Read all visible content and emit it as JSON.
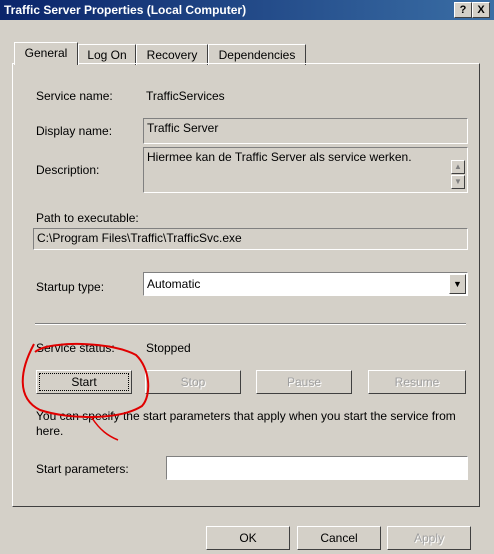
{
  "window": {
    "title": "Traffic Server Properties (Local Computer)",
    "help_btn": "?",
    "close_btn": "X"
  },
  "tabs": [
    {
      "label": "General"
    },
    {
      "label": "Log On"
    },
    {
      "label": "Recovery"
    },
    {
      "label": "Dependencies"
    }
  ],
  "general": {
    "service_name_label": "Service name:",
    "service_name_value": "TrafficServices",
    "display_name_label": "Display name:",
    "display_name_value": "Traffic Server",
    "description_label": "Description:",
    "description_value": "Hiermee kan de Traffic Server als service werken.",
    "path_label": "Path to executable:",
    "path_value": "C:\\Program Files\\Traffic\\TrafficSvc.exe",
    "startup_type_label": "Startup type:",
    "startup_type_value": "Automatic",
    "service_status_label": "Service status:",
    "service_status_value": "Stopped",
    "buttons": {
      "start": "Start",
      "stop": "Stop",
      "pause": "Pause",
      "resume": "Resume"
    },
    "hint_text": "You can specify the start parameters that apply when you start the service from here.",
    "start_params_label": "Start parameters:",
    "start_params_value": ""
  },
  "footer": {
    "ok": "OK",
    "cancel": "Cancel",
    "apply": "Apply"
  },
  "annotation": {
    "color": "#e00000"
  }
}
